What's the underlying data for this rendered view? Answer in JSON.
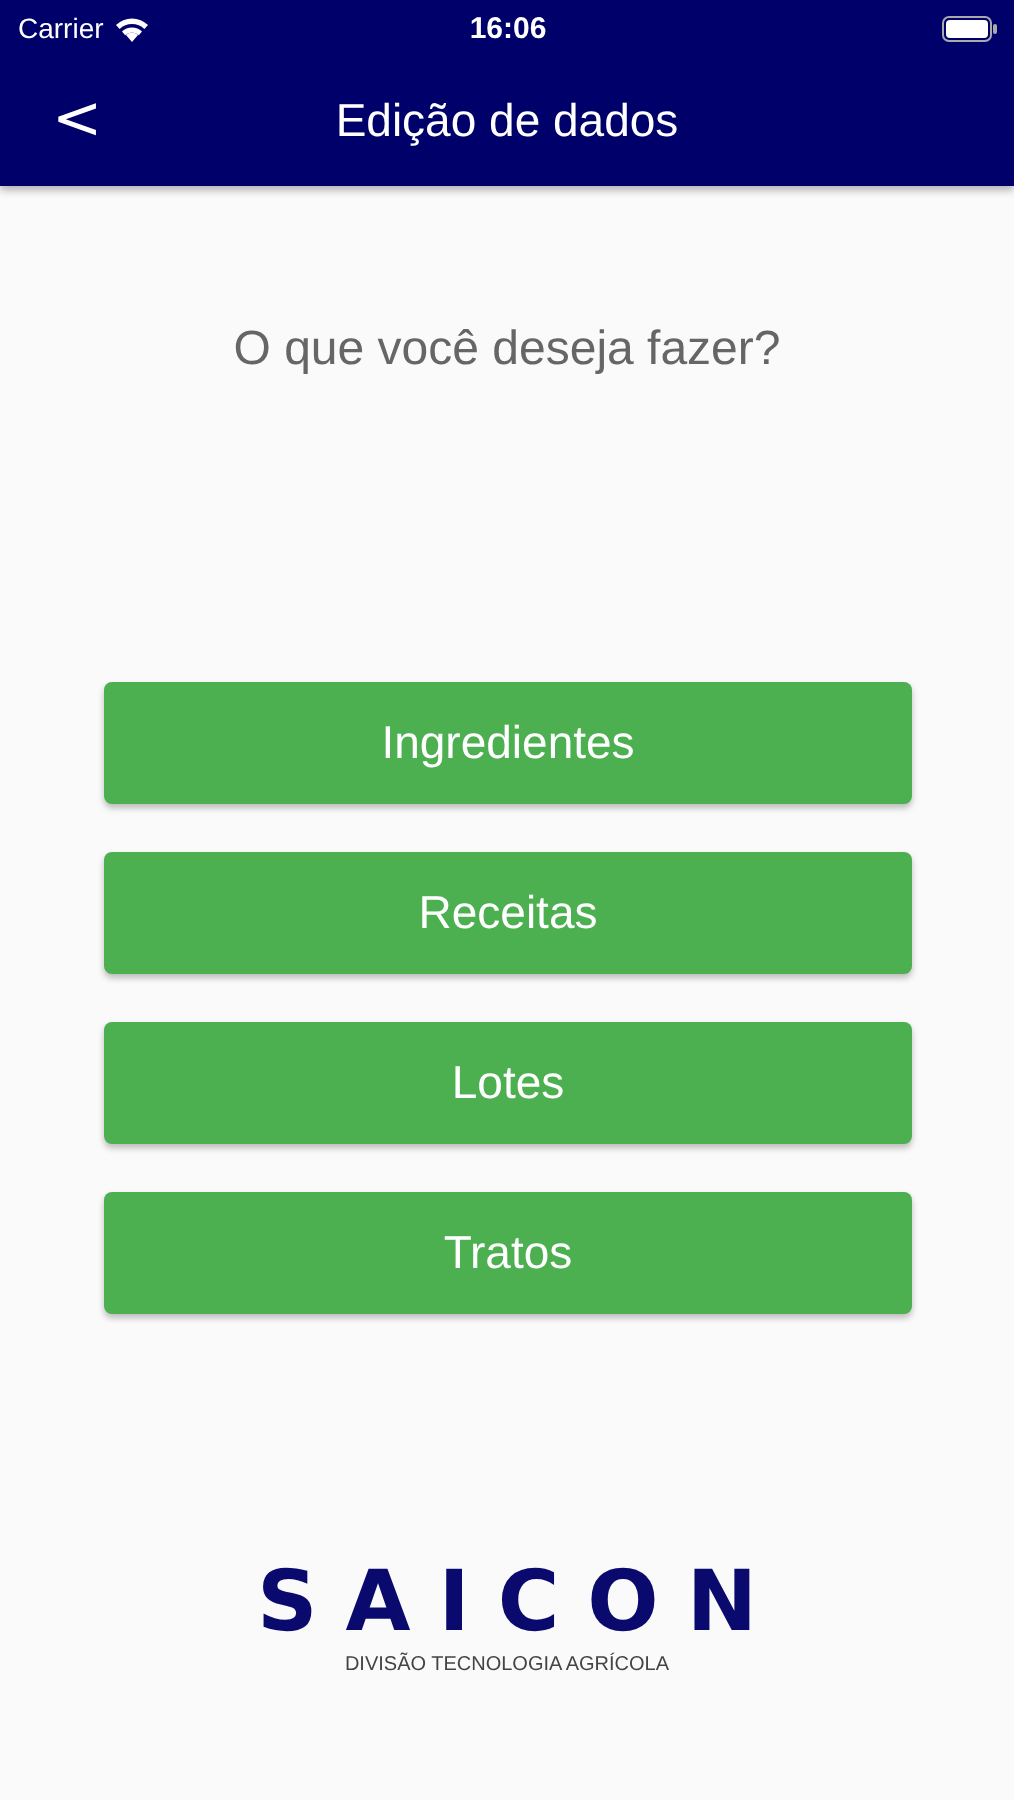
{
  "status_bar": {
    "carrier": "Carrier",
    "time": "16:06"
  },
  "nav_bar": {
    "back": "<",
    "title": "Edição de dados"
  },
  "question": "O que você deseja fazer?",
  "buttons": [
    "Ingredientes",
    "Receitas",
    "Lotes",
    "Tratos"
  ],
  "logo": {
    "wordmark": "SAICON",
    "tagline": "DIVISÃO TECNOLOGIA AGRÍCOLA"
  }
}
